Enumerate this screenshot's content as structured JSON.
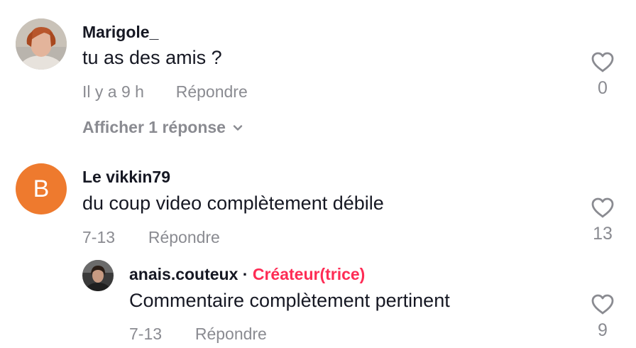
{
  "comments": [
    {
      "username": "Marigole_",
      "text": "tu as des amis ?",
      "time": "Il y a 9 h",
      "reply_label": "Répondre",
      "likes": "0",
      "view_replies_label": "Afficher 1 réponse",
      "avatar_icon": "user-photo-avatar"
    },
    {
      "username": "Le vikkin79",
      "avatar_letter": "B",
      "avatar_color": "#ee7a2e",
      "text": "du coup video complètement débile",
      "time": "7-13",
      "reply_label": "Répondre",
      "likes": "13",
      "replies": [
        {
          "username": "anais.couteux",
          "separator": "·",
          "creator_label": "Créateur(trice)",
          "text": "Commentaire complètement pertinent",
          "time": "7-13",
          "reply_label": "Répondre",
          "likes": "9",
          "avatar_icon": "user-photo-avatar"
        }
      ]
    }
  ],
  "colors": {
    "text_primary": "#161823",
    "text_secondary": "#8a8b91",
    "creator_accent": "#fe2c55"
  },
  "icons": {
    "like": "heart-outline-icon",
    "expand": "chevron-down-icon"
  }
}
